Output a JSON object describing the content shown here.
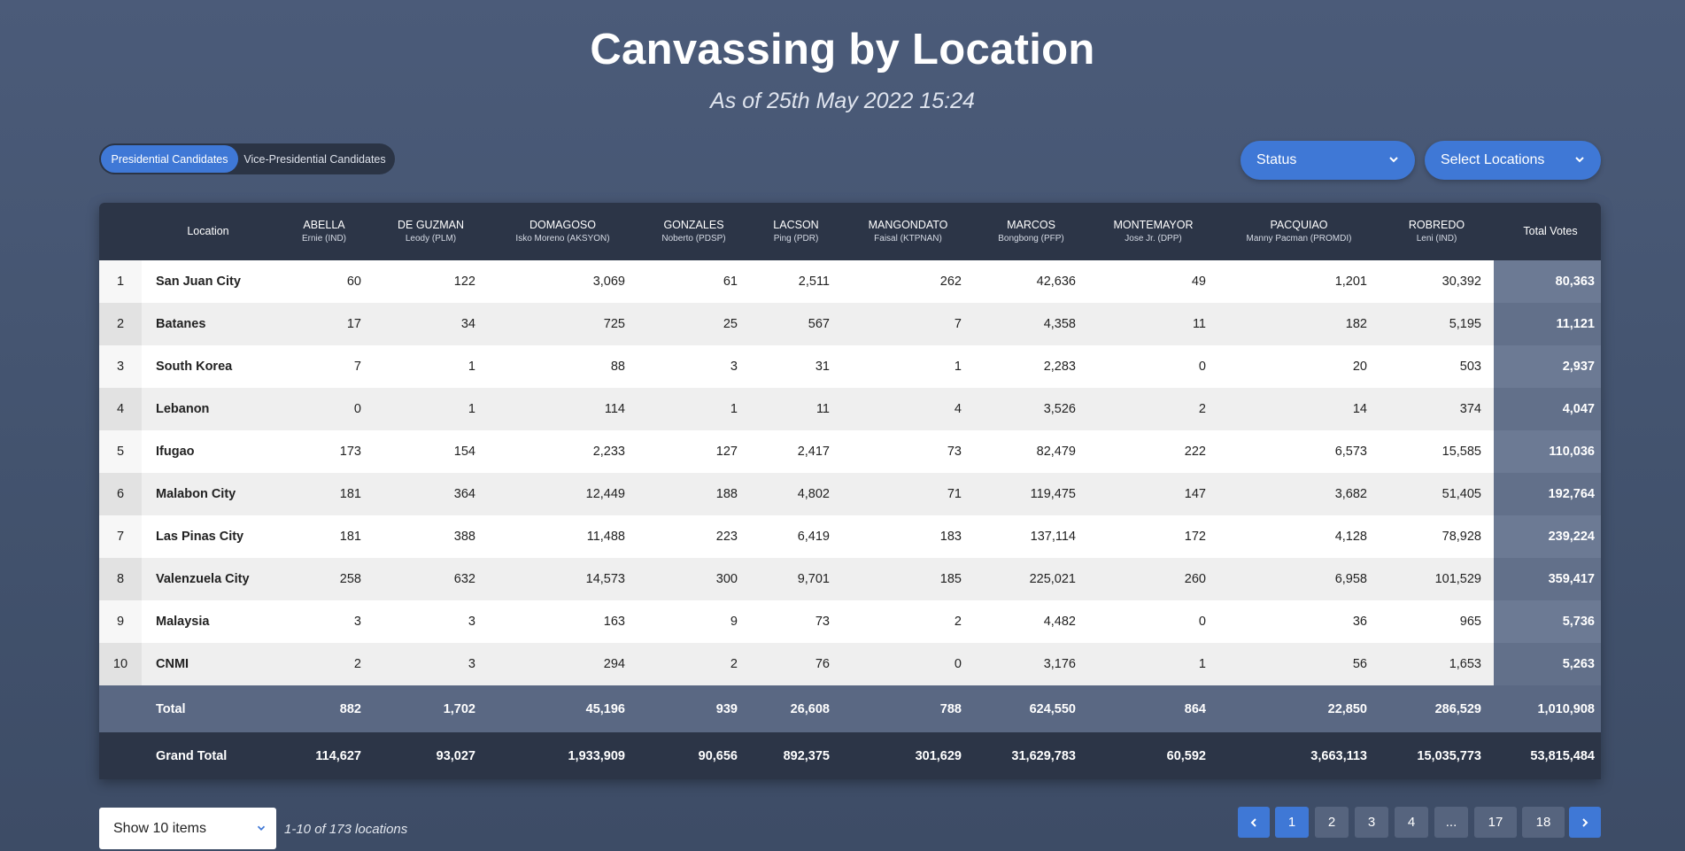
{
  "header": {
    "title": "Canvassing by Location",
    "subtitle": "As of 25th May 2022 15:24"
  },
  "toggle": {
    "presidential": "Presidential Candidates",
    "vice_presidential": "Vice-Presidential Candidates",
    "active": "presidential"
  },
  "filters": {
    "status": "Status",
    "locations": "Select Locations"
  },
  "table": {
    "location_header": "Location",
    "total_header": "Total Votes",
    "candidates": [
      {
        "name": "ABELLA",
        "sub": "Ernie (IND)"
      },
      {
        "name": "DE GUZMAN",
        "sub": "Leody (PLM)"
      },
      {
        "name": "DOMAGOSO",
        "sub": "Isko Moreno (AKSYON)"
      },
      {
        "name": "GONZALES",
        "sub": "Noberto (PDSP)"
      },
      {
        "name": "LACSON",
        "sub": "Ping (PDR)"
      },
      {
        "name": "MANGONDATO",
        "sub": "Faisal (KTPNAN)"
      },
      {
        "name": "MARCOS",
        "sub": "Bongbong (PFP)"
      },
      {
        "name": "MONTEMAYOR",
        "sub": "Jose Jr. (DPP)"
      },
      {
        "name": "PACQUIAO",
        "sub": "Manny Pacman (PROMDI)"
      },
      {
        "name": "ROBREDO",
        "sub": "Leni (IND)"
      }
    ],
    "rows": [
      {
        "rank": "1",
        "location": "San Juan City",
        "values": [
          "60",
          "122",
          "3,069",
          "61",
          "2,511",
          "262",
          "42,636",
          "49",
          "1,201",
          "30,392"
        ],
        "total": "80,363"
      },
      {
        "rank": "2",
        "location": "Batanes",
        "values": [
          "17",
          "34",
          "725",
          "25",
          "567",
          "7",
          "4,358",
          "11",
          "182",
          "5,195"
        ],
        "total": "11,121"
      },
      {
        "rank": "3",
        "location": "South Korea",
        "values": [
          "7",
          "1",
          "88",
          "3",
          "31",
          "1",
          "2,283",
          "0",
          "20",
          "503"
        ],
        "total": "2,937"
      },
      {
        "rank": "4",
        "location": "Lebanon",
        "values": [
          "0",
          "1",
          "114",
          "1",
          "11",
          "4",
          "3,526",
          "2",
          "14",
          "374"
        ],
        "total": "4,047"
      },
      {
        "rank": "5",
        "location": "Ifugao",
        "values": [
          "173",
          "154",
          "2,233",
          "127",
          "2,417",
          "73",
          "82,479",
          "222",
          "6,573",
          "15,585"
        ],
        "total": "110,036"
      },
      {
        "rank": "6",
        "location": "Malabon City",
        "values": [
          "181",
          "364",
          "12,449",
          "188",
          "4,802",
          "71",
          "119,475",
          "147",
          "3,682",
          "51,405"
        ],
        "total": "192,764"
      },
      {
        "rank": "7",
        "location": "Las Pinas City",
        "values": [
          "181",
          "388",
          "11,488",
          "223",
          "6,419",
          "183",
          "137,114",
          "172",
          "4,128",
          "78,928"
        ],
        "total": "239,224"
      },
      {
        "rank": "8",
        "location": "Valenzuela City",
        "values": [
          "258",
          "632",
          "14,573",
          "300",
          "9,701",
          "185",
          "225,021",
          "260",
          "6,958",
          "101,529"
        ],
        "total": "359,417"
      },
      {
        "rank": "9",
        "location": "Malaysia",
        "values": [
          "3",
          "3",
          "163",
          "9",
          "73",
          "2",
          "4,482",
          "0",
          "36",
          "965"
        ],
        "total": "5,736"
      },
      {
        "rank": "10",
        "location": "CNMI",
        "values": [
          "2",
          "3",
          "294",
          "2",
          "76",
          "0",
          "3,176",
          "1",
          "56",
          "1,653"
        ],
        "total": "5,263"
      }
    ],
    "total_row": {
      "label": "Total",
      "values": [
        "882",
        "1,702",
        "45,196",
        "939",
        "26,608",
        "788",
        "624,550",
        "864",
        "22,850",
        "286,529"
      ],
      "total": "1,010,908"
    },
    "grand_total_row": {
      "label": "Grand Total",
      "values": [
        "114,627",
        "93,027",
        "1,933,909",
        "90,656",
        "892,375",
        "301,629",
        "31,629,783",
        "60,592",
        "3,663,113",
        "15,035,773"
      ],
      "total": "53,815,484"
    }
  },
  "footer": {
    "page_size": "Show 10 items",
    "range": "1-10 of 173 locations",
    "pages": [
      "1",
      "2",
      "3",
      "4",
      "...",
      "17",
      "18"
    ],
    "current_page": "1"
  },
  "colors": {
    "accent": "#3f78d6",
    "header_dark": "#2c3547",
    "background": "#4b5b79"
  }
}
